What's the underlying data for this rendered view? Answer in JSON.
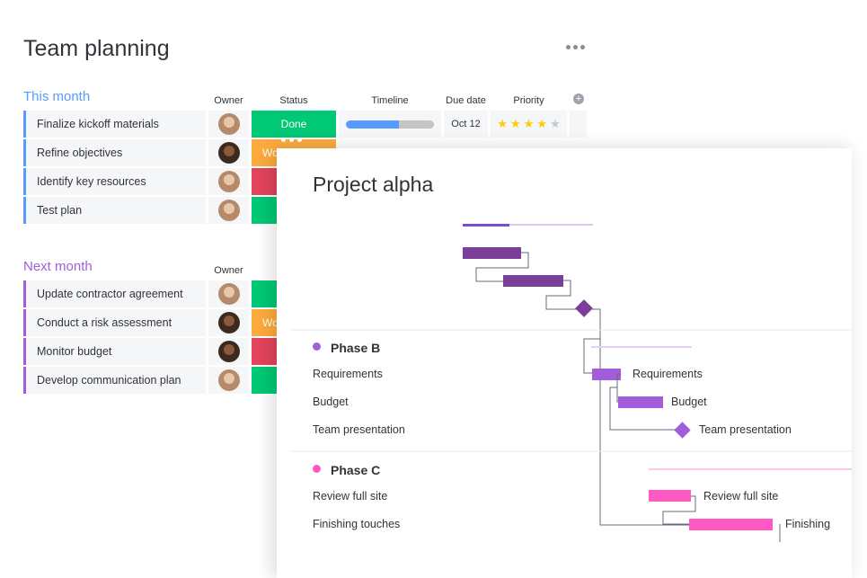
{
  "page": {
    "title": "Team planning"
  },
  "columns": {
    "owner": "Owner",
    "status": "Status",
    "timeline": "Timeline",
    "due_date": "Due date",
    "priority": "Priority"
  },
  "groups": [
    {
      "title": "This month",
      "color": "#579bfc",
      "rows": [
        {
          "name": "Finalize kickoff materials",
          "status": "Done",
          "status_color": "#00c875",
          "timeline_progress": 0.6,
          "due": "Oct 12",
          "stars": 4,
          "stars_max": 5
        },
        {
          "name": "Refine objectives",
          "status": "Wo",
          "status_color": "#fdab3d"
        },
        {
          "name": "Identify key resources",
          "status": "",
          "status_color": "#e2445c"
        },
        {
          "name": "Test plan",
          "status": "",
          "status_color": "#00c875"
        }
      ]
    },
    {
      "title": "Next month",
      "color": "#a25ddc",
      "rows": [
        {
          "name": "Update contractor agreement",
          "status": "",
          "status_color": "#00c875"
        },
        {
          "name": "Conduct a risk assessment",
          "status": "Wo",
          "status_color": "#fdab3d"
        },
        {
          "name": "Monitor budget",
          "status": "",
          "status_color": "#e2445c"
        },
        {
          "name": "Develop communication plan",
          "status": "",
          "status_color": "#00c875"
        }
      ]
    }
  ],
  "gantt": {
    "title": "Project alpha",
    "phase_b": {
      "title": "Phase B",
      "color": "#a25ddc",
      "tasks": [
        "Requirements",
        "Budget",
        "Team presentation"
      ],
      "bar_labels": [
        "Requirements",
        "Budget",
        "Team presentation"
      ]
    },
    "phase_c": {
      "title": "Phase C",
      "color": "#ff5ac4",
      "tasks": [
        "Review full site",
        "Finishing touches"
      ],
      "bar_labels": [
        "Review full site",
        "Finishing"
      ]
    },
    "phase_a_color": "#784bd1"
  },
  "icons": {
    "more": "more-dots-icon",
    "add_column": "plus-icon"
  }
}
